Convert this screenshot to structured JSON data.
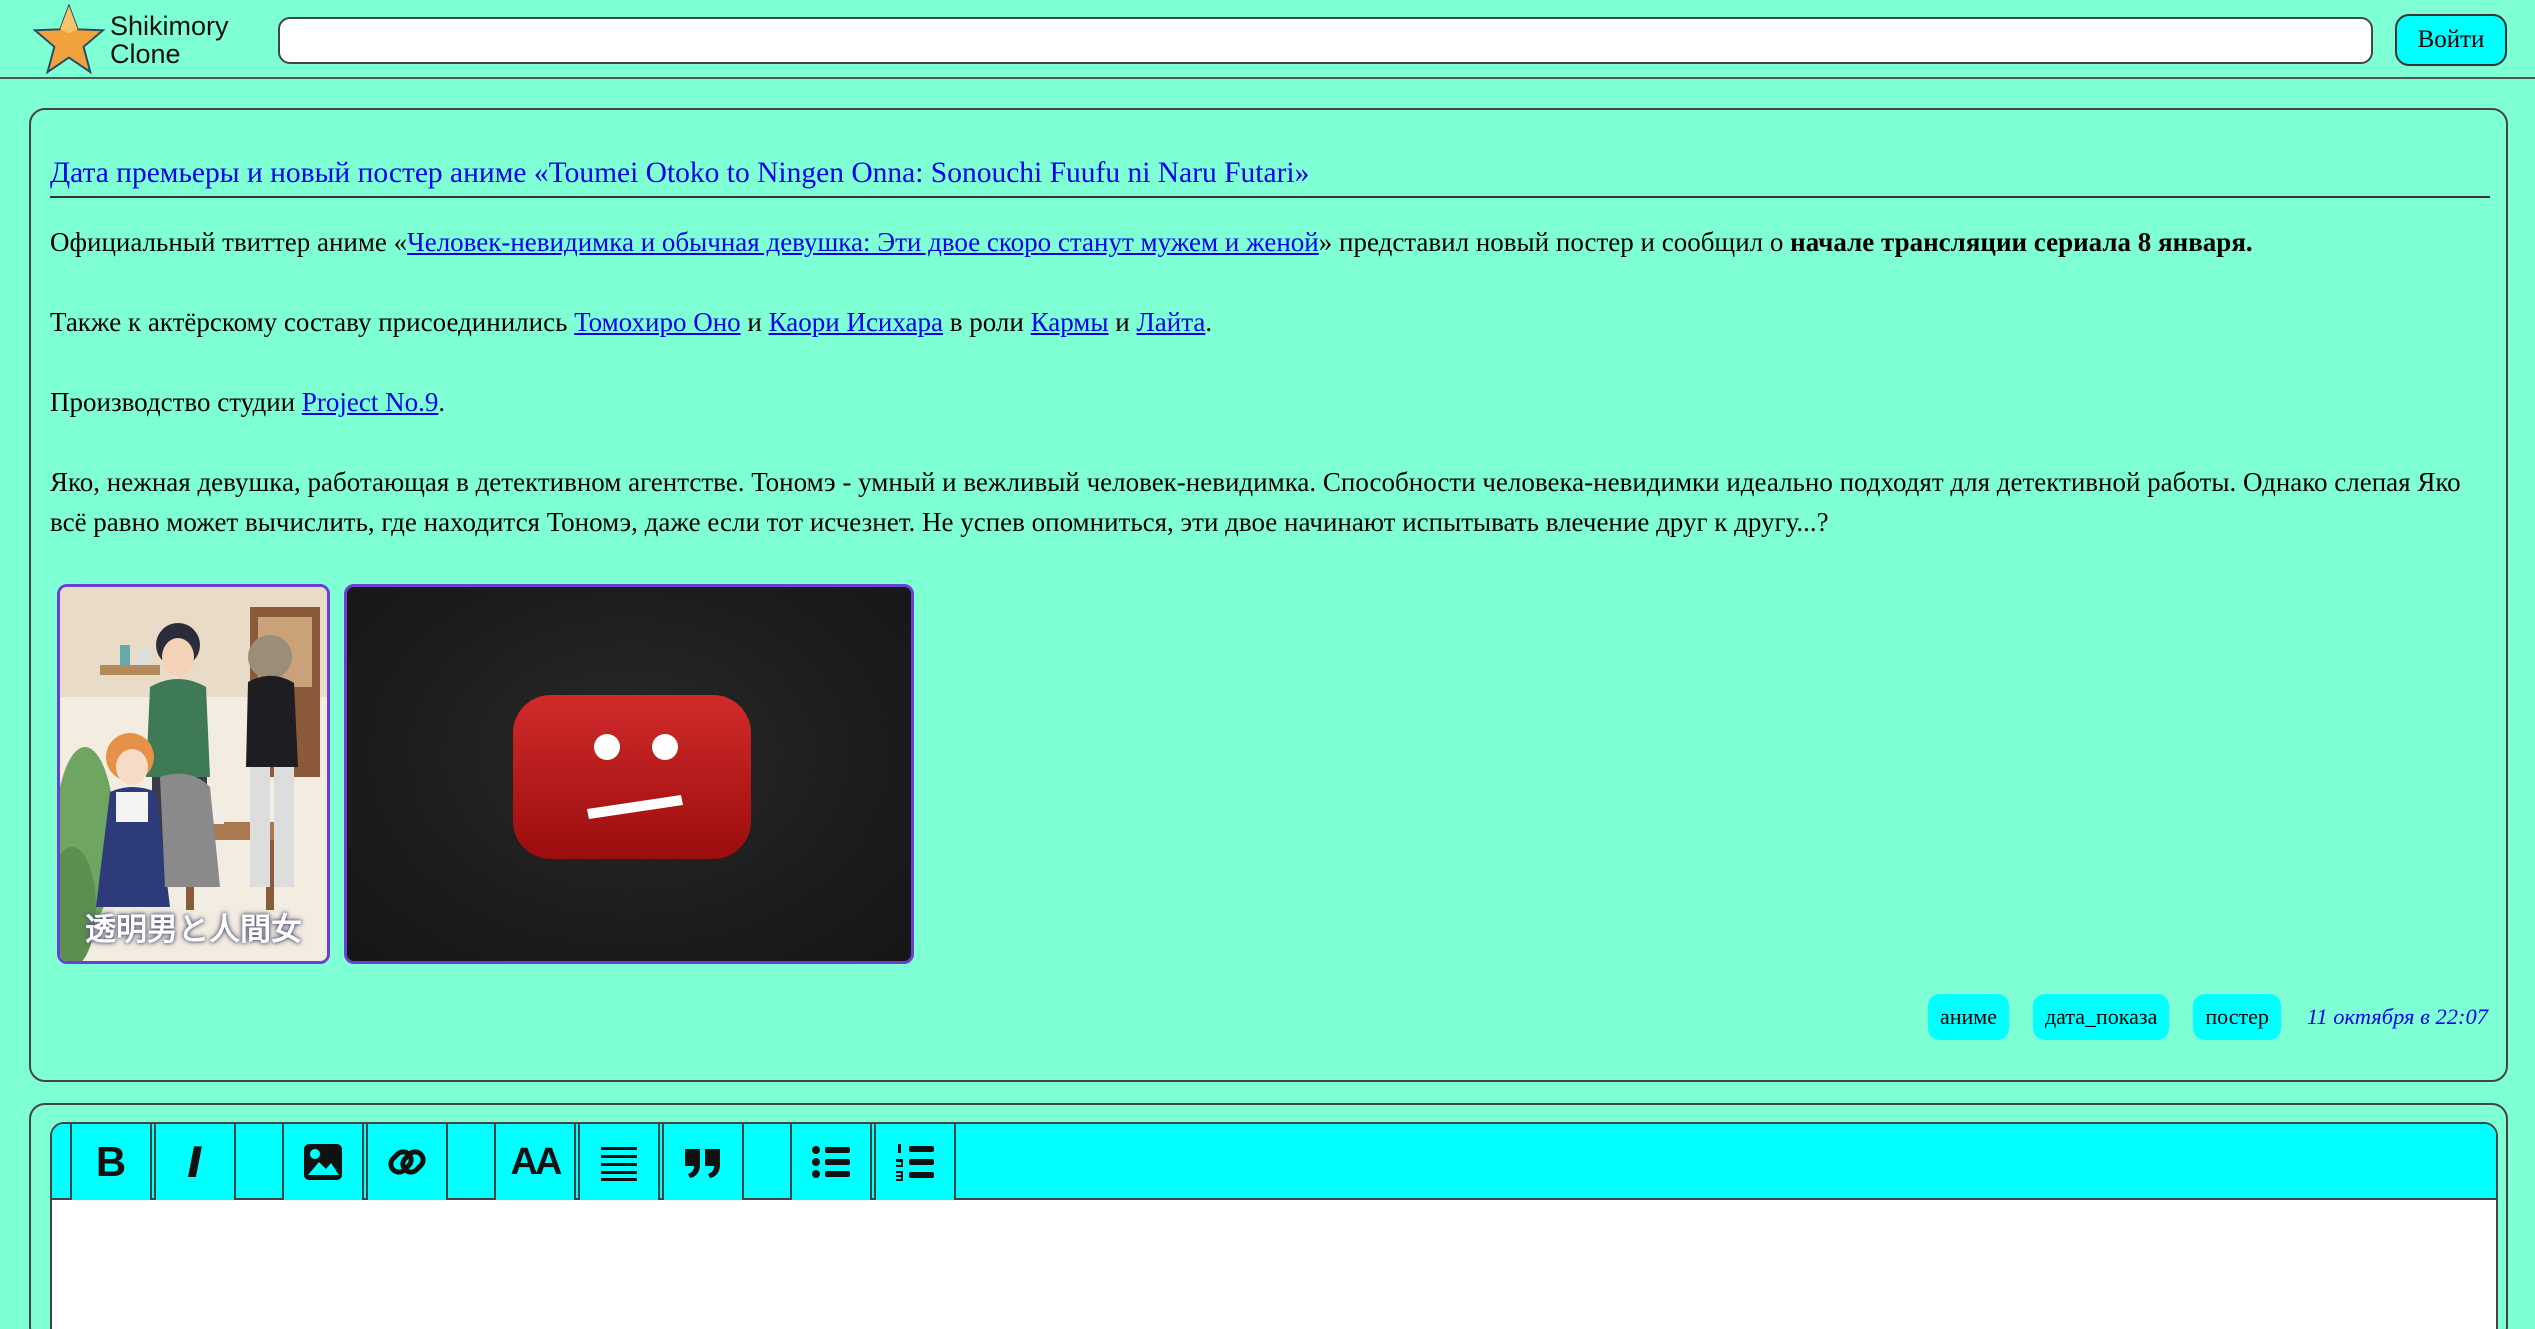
{
  "header": {
    "logo_line1": "Shikimory",
    "logo_line2": "Clone",
    "search_value": "",
    "search_placeholder": "",
    "login_label": "Войти"
  },
  "article": {
    "title": "Дата премьеры и новый постер аниме «Toumei Otoko to Ningen Onna: Sonouchi Fuufu ni Naru Futari»",
    "p1_prefix": "Официальный твиттер аниме «",
    "p1_link": "Человек-невидимка и обычная девушка: Эти двое скоро станут мужем и женой",
    "p1_middle": "» представил новый постер и сообщил о ",
    "p1_bold": "начале трансляции сериала 8 января.",
    "p2_prefix": "Также к актёрскому составу присоединились ",
    "p2_link1": "Томохиро Оно",
    "p2_and1": " и ",
    "p2_link2": "Каори Исихара",
    "p2_roles": " в роли ",
    "p2_link3": "Кармы",
    "p2_and2": " и ",
    "p2_link4": "Лайта",
    "p2_end": ".",
    "p3_prefix": "Производство студии ",
    "p3_link": "Project No.9",
    "p3_end": ".",
    "p4": "Яко, нежная девушка, работающая в детективном агентстве. Тономэ - умный и вежливый человек-невидимка. Способности человека-невидимки идеально подходят для детективной работы. Однако слепая Яко всё равно может вычислить, где находится Тономэ, даже если тот исчезнет. Не успев опомниться, эти двое начинают испытывать влечение друг к другу...?",
    "poster_caption": "透明男と人間女",
    "tags": [
      "аниме",
      "дата_показа",
      "постер"
    ],
    "date": "11 октября в 22:07"
  },
  "editor": {
    "bold_icon": "B",
    "italic_icon": "I",
    "font_size_icon": "AA",
    "tools": [
      "bold-icon",
      "italic-icon",
      "image-icon",
      "link-icon",
      "font-size-icon",
      "align-icon",
      "quote-icon",
      "bullet-list-icon",
      "numbered-list-icon"
    ]
  },
  "colors": {
    "background": "#7fffd4",
    "accent": "#00ffff",
    "link": "#0000ee",
    "media_border": "#6a3fd6"
  }
}
